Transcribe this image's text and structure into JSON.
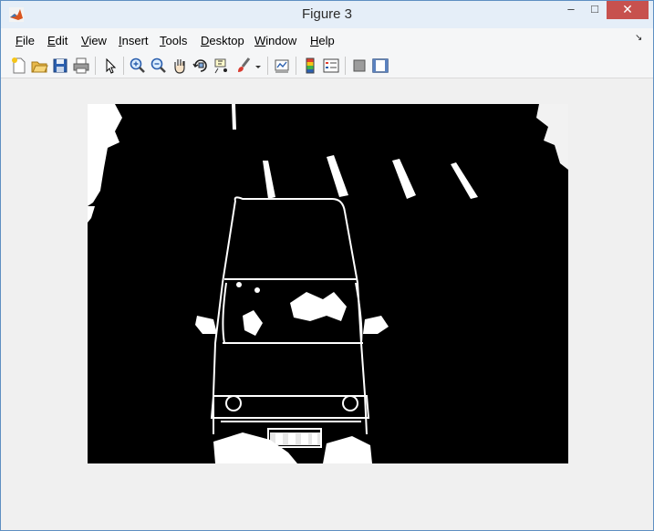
{
  "window": {
    "title": "Figure 3",
    "controls": {
      "minimize": "–",
      "maximize": "□",
      "close": "✕"
    }
  },
  "menubar": {
    "items": [
      {
        "label": "File",
        "mnemonic": "F"
      },
      {
        "label": "Edit",
        "mnemonic": "E"
      },
      {
        "label": "View",
        "mnemonic": "V"
      },
      {
        "label": "Insert",
        "mnemonic": "I"
      },
      {
        "label": "Tools",
        "mnemonic": "T"
      },
      {
        "label": "Desktop",
        "mnemonic": "D"
      },
      {
        "label": "Window",
        "mnemonic": "W"
      },
      {
        "label": "Help",
        "mnemonic": "H"
      }
    ],
    "dock_arrow": "↘"
  },
  "toolbar": {
    "icons": [
      "new-figure-icon",
      "open-file-icon",
      "save-icon",
      "print-icon",
      "edit-plot-icon",
      "zoom-in-icon",
      "zoom-out-icon",
      "pan-icon",
      "rotate-3d-icon",
      "data-cursor-icon",
      "brush-icon",
      "brush-dropdown-icon",
      "link-plot-icon",
      "colorbar-icon",
      "legend-icon",
      "hide-plot-tools-icon",
      "show-plot-tools-icon"
    ]
  },
  "figure": {
    "content": "binary-edge-image-vehicle",
    "colors": {
      "background": "#000000",
      "foreground": "#ffffff"
    }
  }
}
